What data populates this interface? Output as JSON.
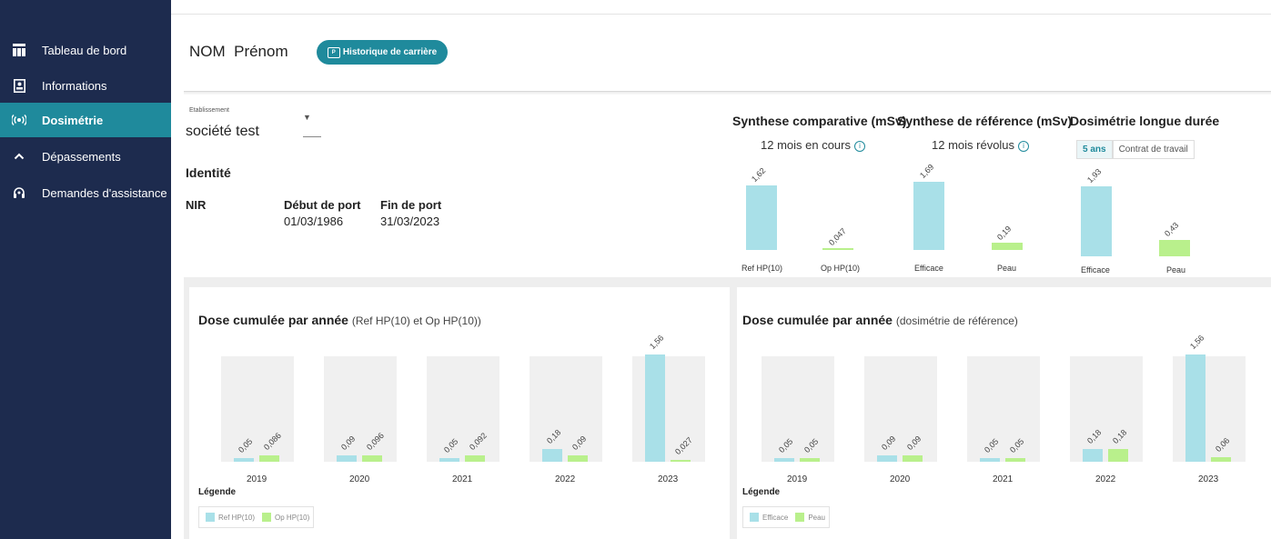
{
  "sidebar": {
    "items": [
      {
        "label": "Tableau de bord",
        "icon": "dashboard-icon"
      },
      {
        "label": "Informations",
        "icon": "id-card-icon"
      },
      {
        "label": "Dosimétrie",
        "icon": "radiation-icon"
      },
      {
        "label": "Dépassements",
        "icon": "chevron-up-icon"
      },
      {
        "label": "Demandes d'assistance",
        "icon": "headset-icon"
      }
    ]
  },
  "header": {
    "name": "NOM  Prénom",
    "history_button": "Historique de carrière"
  },
  "establishment": {
    "label": "Etablissement",
    "value": "société test"
  },
  "identity": {
    "title": "Identité",
    "nir_label": "NIR",
    "start_label": "Début de port",
    "start_value": "01/03/1986",
    "end_label": "Fin de port",
    "end_value": "31/03/2023"
  },
  "summary": {
    "comparative": {
      "title": "Synthese comparative (mSv)",
      "subtitle": "12 mois en cours",
      "labels": [
        "Ref HP(10)",
        "Op HP(10)"
      ],
      "values": [
        "1,62",
        "0,047"
      ]
    },
    "reference": {
      "title": "Synthese de référence (mSv)",
      "subtitle": "12 mois révolus",
      "labels": [
        "Efficace",
        "Peau"
      ],
      "values": [
        "1,69",
        "0,19"
      ]
    },
    "long_term": {
      "title": "Dosimétrie longue durée",
      "tabs": [
        "5 ans",
        "Contrat de travail"
      ],
      "labels": [
        "Efficace",
        "Peau"
      ],
      "values": [
        "1,93",
        "0,43"
      ]
    }
  },
  "chart_left": {
    "title": "Dose cumulée par année",
    "subtitle": "(Ref HP(10) et Op HP(10))",
    "legend_title": "Légende",
    "legend": [
      "Ref HP(10)",
      "Op HP(10)"
    ],
    "years": [
      "2019",
      "2020",
      "2021",
      "2022",
      "2023"
    ],
    "blue_labels": [
      "0,05",
      "0,09",
      "0,05",
      "0,18",
      "1,56"
    ],
    "green_labels": [
      "0,086",
      "0,096",
      "0,092",
      "0,09",
      "0,027"
    ]
  },
  "chart_right": {
    "title": "Dose cumulée par année",
    "subtitle": "(dosimétrie de référence)",
    "legend_title": "Légende",
    "legend": [
      "Efficace",
      "Peau"
    ],
    "years": [
      "2019",
      "2020",
      "2021",
      "2022",
      "2023"
    ],
    "blue_labels": [
      "0,05",
      "0,09",
      "0,05",
      "0,18",
      "1,56"
    ],
    "green_labels": [
      "0,05",
      "0,09",
      "0,05",
      "0,18",
      "0,06"
    ]
  },
  "colors": {
    "sidebar_bg": "#1d2b4e",
    "accent": "#1f8a9c",
    "series_blue": "#a9e0e8",
    "series_green": "#b9f08c"
  },
  "chart_data": [
    {
      "type": "bar",
      "title": "Synthese comparative (mSv)",
      "subtitle": "12 mois en cours",
      "categories": [
        "Ref HP(10)",
        "Op HP(10)"
      ],
      "values": [
        1.62,
        0.047
      ]
    },
    {
      "type": "bar",
      "title": "Synthese de référence (mSv)",
      "subtitle": "12 mois révolus",
      "categories": [
        "Efficace",
        "Peau"
      ],
      "values": [
        1.69,
        0.19
      ]
    },
    {
      "type": "bar",
      "title": "Dosimétrie longue durée",
      "categories": [
        "Efficace",
        "Peau"
      ],
      "values": [
        1.93,
        0.43
      ]
    },
    {
      "type": "bar",
      "title": "Dose cumulée par année",
      "subtitle": "(Ref HP(10) et Op HP(10))",
      "categories": [
        "2019",
        "2020",
        "2021",
        "2022",
        "2023"
      ],
      "series": [
        {
          "name": "Ref HP(10)",
          "values": [
            0.05,
            0.09,
            0.05,
            0.18,
            1.56
          ]
        },
        {
          "name": "Op HP(10)",
          "values": [
            0.086,
            0.096,
            0.092,
            0.09,
            0.027
          ]
        }
      ]
    },
    {
      "type": "bar",
      "title": "Dose cumulée par année",
      "subtitle": "(dosimétrie de référence)",
      "categories": [
        "2019",
        "2020",
        "2021",
        "2022",
        "2023"
      ],
      "series": [
        {
          "name": "Efficace",
          "values": [
            0.05,
            0.09,
            0.05,
            0.18,
            1.56
          ]
        },
        {
          "name": "Peau",
          "values": [
            0.05,
            0.09,
            0.05,
            0.18,
            0.06
          ]
        }
      ]
    }
  ]
}
